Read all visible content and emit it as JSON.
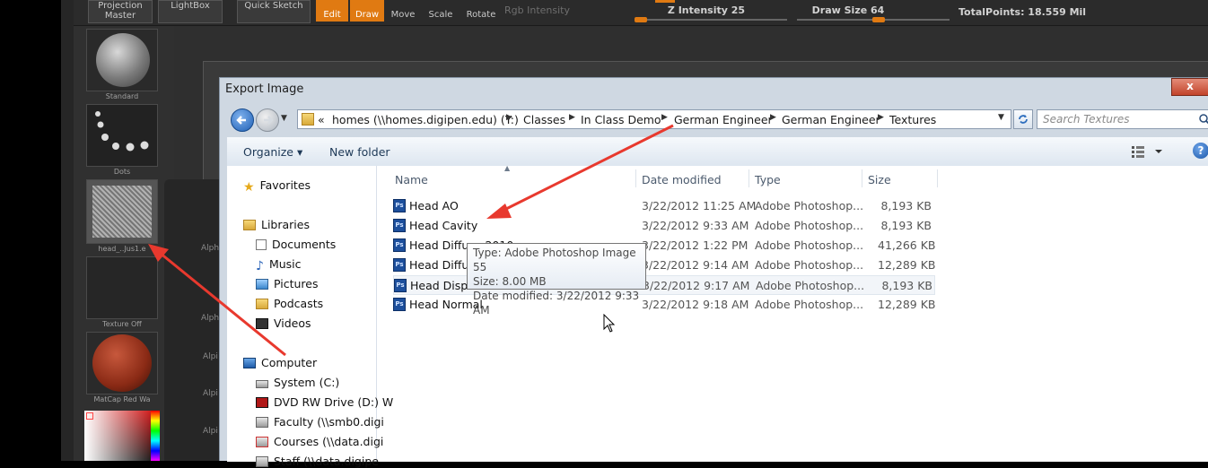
{
  "zbrush": {
    "top_left_btn": "Projection Master",
    "lightbox": "LightBox",
    "quick_sketch": "Quick Sketch",
    "edit": "Edit",
    "draw": "Draw",
    "move": "Move",
    "scale": "Scale",
    "rotate": "Rotate",
    "rgb_intensity": "Rgb Intensity",
    "z_intensity": "Z Intensity 25",
    "draw_size": "Draw Size 64",
    "total_points": "TotalPoints: 18.559 Mil",
    "slots": {
      "standard": "Standard",
      "dots": "Dots",
      "texture": "head_..Jus1.e",
      "texture_off": "Texture  Off",
      "matcap": "MatCap  Red  Wa"
    },
    "alpha_labels": [
      "Alph",
      "Alph",
      "Alpi",
      "Alpi",
      "Alpi"
    ],
    "accent_color": "#e07a12"
  },
  "dialog": {
    "title": "Export Image",
    "close_label": "x",
    "address": {
      "overflow": "«",
      "segments": [
        "homes (\\\\homes.digipen.edu) (Y:)",
        "Classes",
        "In Class Demo",
        "German Engineer",
        "German Engineer",
        "Textures"
      ]
    },
    "search_placeholder": "Search Textures",
    "toolbar": {
      "organize": "Organize ▾",
      "new_folder": "New folder"
    },
    "nav": {
      "favorites": "Favorites",
      "libraries": "Libraries",
      "documents": "Documents",
      "music": "Music",
      "pictures": "Pictures",
      "podcasts": "Podcasts",
      "videos": "Videos",
      "computer": "Computer",
      "system": "System (C:)",
      "dvd": "DVD RW Drive (D:) W",
      "faculty": "Faculty (\\\\smb0.digi",
      "courses": "Courses (\\\\data.digi",
      "staff": "Staff (\\\\data.digipe"
    },
    "columns": {
      "name": "Name",
      "date": "Date modified",
      "type": "Type",
      "size": "Size"
    },
    "files": [
      {
        "name": "Head AO",
        "date": "3/22/2012 11:25 AM",
        "type": "Adobe Photoshop...",
        "size": "8,193 KB"
      },
      {
        "name": "Head Cavity",
        "date": "3/22/2012 9:33 AM",
        "type": "Adobe Photoshop...",
        "size": "8,193 KB"
      },
      {
        "name": "Head Diffuse 2010",
        "date": "3/22/2012 1:22 PM",
        "type": "Adobe Photoshop...",
        "size": "41,266 KB"
      },
      {
        "name": "Head Diffuse",
        "date": "3/22/2012 9:14 AM",
        "type": "Adobe Photoshop...",
        "size": "12,289 KB"
      },
      {
        "name": "Head Displacement",
        "date": "3/22/2012 9:17 AM",
        "type": "Adobe Photoshop...",
        "size": "8,193 KB"
      },
      {
        "name": "Head Normal",
        "date": "3/22/2012 9:18 AM",
        "type": "Adobe Photoshop...",
        "size": "12,289 KB"
      }
    ],
    "tooltip": {
      "type": "Type: Adobe Photoshop Image 55",
      "size": "Size: 8.00 MB",
      "date": "Date modified: 3/22/2012 9:33 AM"
    },
    "annotation_color": "#e8392e"
  }
}
